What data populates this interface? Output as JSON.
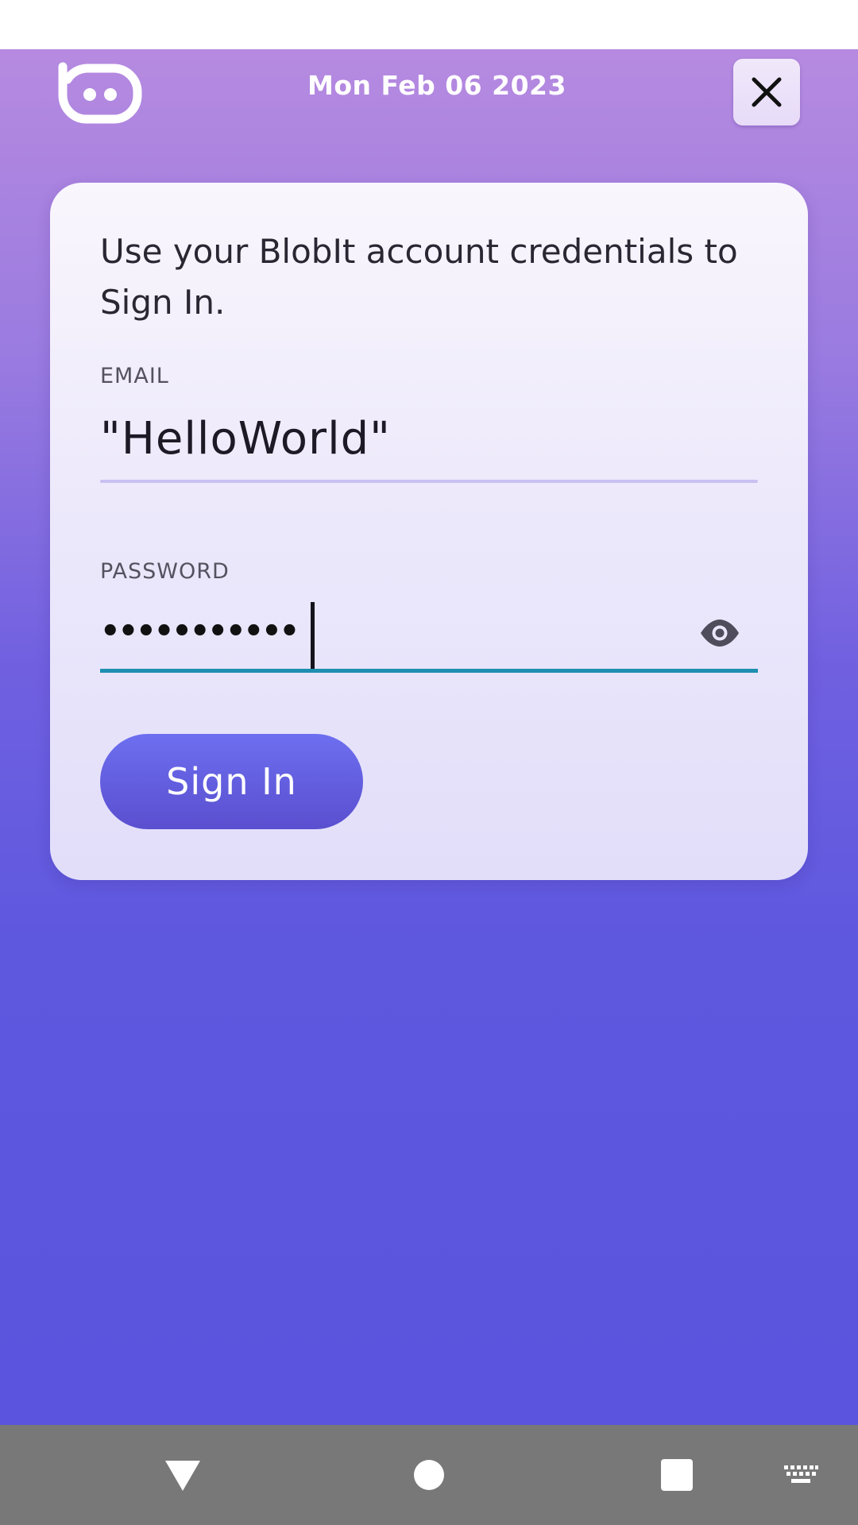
{
  "header": {
    "date": "Mon Feb 06 2023",
    "logo_icon": "blobit-logo-icon",
    "close_icon": "close-icon"
  },
  "login": {
    "intro": "Use your BlobIt account credentials to Sign In.",
    "email_label": "EMAIL",
    "email_value": "\"HelloWorld\"",
    "password_label": "PASSWORD",
    "password_masked": "•••••••••••",
    "show_password_icon": "eye-icon",
    "signin_label": "Sign In"
  },
  "navigation": {
    "back_icon": "triangle-back-icon",
    "home_icon": "circle-home-icon",
    "recents_icon": "square-recents-icon",
    "keyboard_icon": "keyboard-icon"
  },
  "colors": {
    "gradient_top": "#b68ae0",
    "gradient_bottom": "#5a54de",
    "card_background": "#f5f2fc",
    "focus_underline": "#1f8fb0",
    "signin_button": "#6066e6",
    "nav_bar": "#787878"
  }
}
